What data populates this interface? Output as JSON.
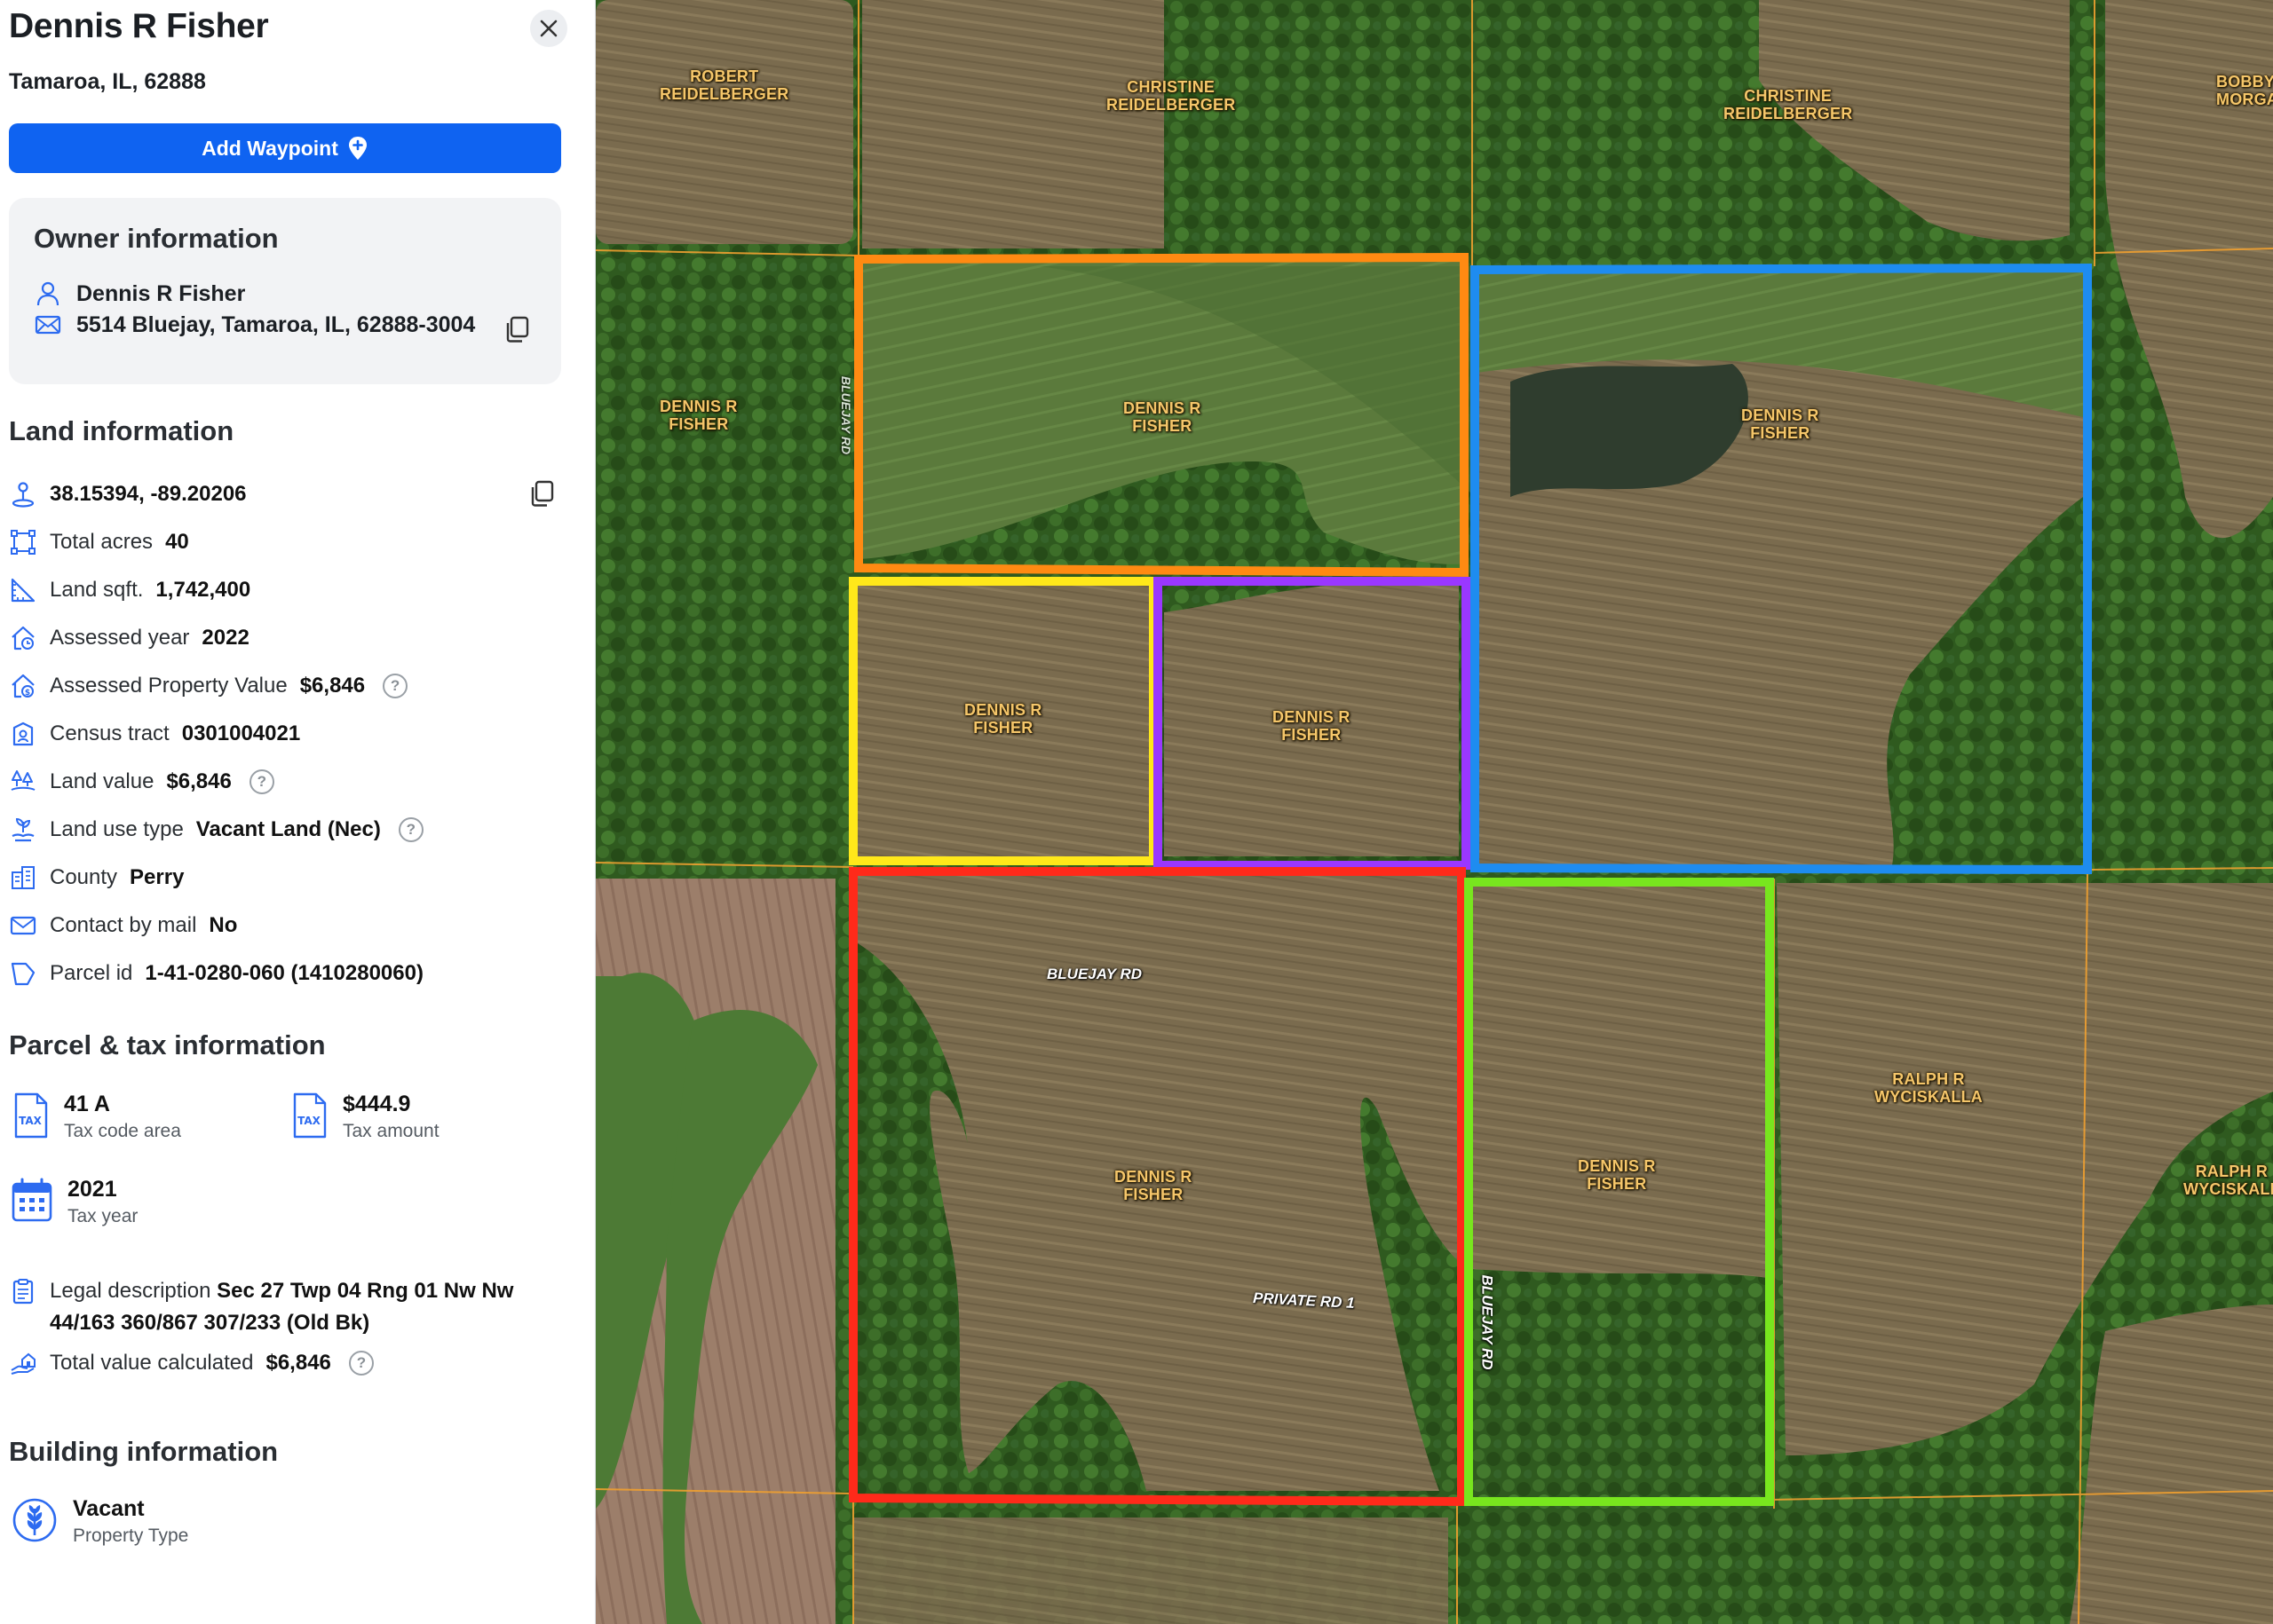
{
  "header": {
    "owner_name": "Dennis R Fisher",
    "location": "Tamaroa, IL, 62888",
    "add_waypoint_label": "Add Waypoint"
  },
  "owner_info": {
    "title": "Owner information",
    "name": "Dennis R Fisher",
    "address": "5514 Bluejay, Tamaroa, IL, 62888-3004"
  },
  "land_info": {
    "title": "Land information",
    "coordinates": "38.15394, -89.20206",
    "total_acres_label": "Total acres",
    "total_acres": "40",
    "land_sqft_label": "Land sqft.",
    "land_sqft": "1,742,400",
    "assessed_year_label": "Assessed year",
    "assessed_year": "2022",
    "assessed_value_label": "Assessed Property Value",
    "assessed_value": "$6,846",
    "census_tract_label": "Census tract",
    "census_tract": "0301004021",
    "land_value_label": "Land value",
    "land_value": "$6,846",
    "land_use_label": "Land use type",
    "land_use": "Vacant Land (Nec)",
    "county_label": "County",
    "county": "Perry",
    "contact_mail_label": "Contact by mail",
    "contact_mail": "No",
    "parcel_id_label": "Parcel id",
    "parcel_id": "1-41-0280-060 (1410280060)"
  },
  "tax_info": {
    "title": "Parcel & tax information",
    "tax_code_area": "41 A",
    "tax_code_area_label": "Tax code area",
    "tax_amount": "$444.9",
    "tax_amount_label": "Tax amount",
    "tax_year": "2021",
    "tax_year_label": "Tax year",
    "tax_icon_text": "TAX",
    "legal_label": "Legal description",
    "legal_value": "Sec 27 Twp 04 Rng 01 Nw Nw 44/163 360/867 307/233 (Old Bk)",
    "total_calc_label": "Total value calculated",
    "total_calc": "$6,846"
  },
  "building_info": {
    "title": "Building information",
    "property_type": "Vacant",
    "property_type_label": "Property Type"
  },
  "map": {
    "labels": {
      "robert": "ROBERT\nREIDELBERGER",
      "christine1": "CHRISTINE\nREIDELBERGER",
      "christine2": "CHRISTINE\nREIDELBERGER",
      "bobby": "BOBBY\nMORGA",
      "fisher_west": "DENNIS R\nFISHER",
      "fisher_orange": "DENNIS R\nFISHER",
      "fisher_blue": "DENNIS R\nFISHER",
      "fisher_yellow": "DENNIS R\nFISHER",
      "fisher_purple": "DENNIS R\nFISHER",
      "fisher_red": "DENNIS R\nFISHER",
      "fisher_green": "DENNIS R\nFISHER",
      "ralph1": "RALPH R\nWYCISKALLA",
      "ralph2": "RALPH R\nWYCISKALL",
      "road_bluejay": "BLUEJAY RD",
      "road_private": "PRIVATE RD 1",
      "road_bluejay_vert": "BLUEJAY RD",
      "road_west_vert": "BLUEJAY RD"
    },
    "colors": {
      "orange": "#ff8a12",
      "blue": "#1e8cf0",
      "yellow": "#ffe81a",
      "purple": "#9a37ff",
      "red": "#ff2a1a",
      "green": "#78e61e",
      "parcel_line": "#f0a030"
    }
  },
  "icons": {
    "close": "close-icon",
    "pin": "map-pin-plus-icon",
    "person": "person-icon",
    "mail": "envelope-icon",
    "copy": "copy-icon",
    "coords": "location-pin-icon",
    "acres": "area-frame-icon",
    "sqft": "ruler-triangle-icon",
    "year": "house-calendar-icon",
    "value": "house-dollar-icon",
    "census": "census-building-icon",
    "land_value": "trees-dollar-icon",
    "land_use": "plant-hand-icon",
    "county": "buildings-icon",
    "contact": "envelope-icon",
    "parcel": "parcel-shape-icon",
    "tax": "tax-document-icon",
    "calendar": "calendar-icon",
    "legal": "clipboard-icon",
    "total": "hand-house-icon",
    "vacant": "wheat-icon"
  }
}
